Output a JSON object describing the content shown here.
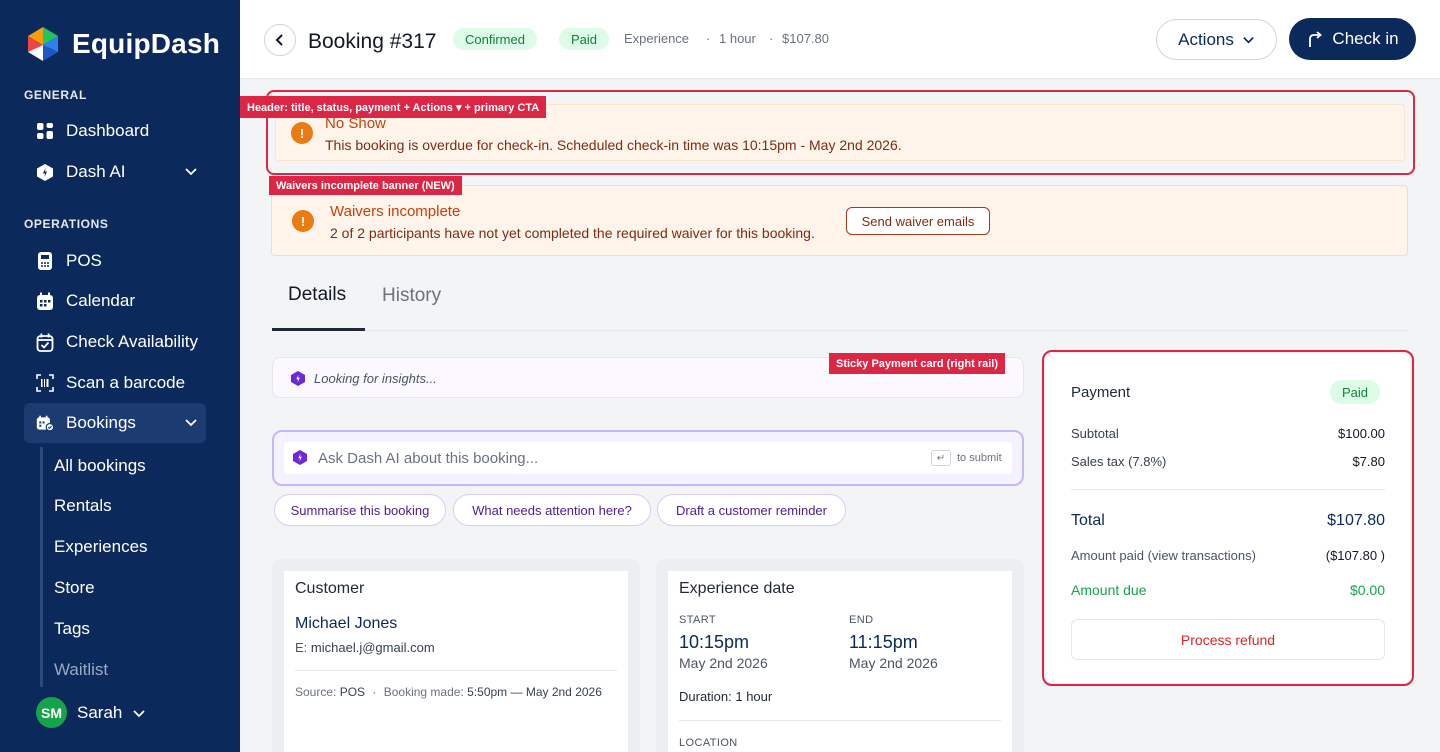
{
  "app": {
    "name": "EquipDash"
  },
  "sidebar": {
    "section_general": "GENERAL",
    "section_operations": "OPERATIONS",
    "items": [
      {
        "label": "Dashboard",
        "icon": "grid-icon"
      },
      {
        "label": "Dash AI",
        "icon": "ai-hex-icon"
      },
      {
        "label": "POS",
        "icon": "pos-terminal-icon"
      },
      {
        "label": "Calendar",
        "icon": "calendar-icon"
      },
      {
        "label": "Check Availability",
        "icon": "calendar-check-icon"
      },
      {
        "label": "Scan a barcode",
        "icon": "barcode-scan-icon"
      },
      {
        "label": "Bookings",
        "icon": "bookings-icon"
      }
    ],
    "sub_items": [
      {
        "label": "All bookings"
      },
      {
        "label": "Rentals"
      },
      {
        "label": "Experiences"
      },
      {
        "label": "Store"
      },
      {
        "label": "Tags"
      },
      {
        "label": "Waitlist"
      }
    ],
    "user": {
      "initials": "SM",
      "name": "Sarah"
    }
  },
  "header": {
    "title": "Booking #317",
    "status": "Confirmed",
    "payment_status": "Paid",
    "type": "Experience",
    "sep1": "·",
    "duration": "1 hour",
    "sep2": "·",
    "amount": "$107.80",
    "actions_label": "Actions",
    "checkin_label": "Check in"
  },
  "annotations": {
    "header_tag": "Header: title, status, payment + Actions ▾ + primary CTA",
    "waivers_tag": "Waivers incomplete banner (NEW)",
    "payment_tag": "Sticky Payment card (right rail)"
  },
  "banners": {
    "no_show": {
      "title": "No Show",
      "text": "This booking is overdue for check-in. Scheduled check-in time was 10:15pm - May 2nd 2026."
    },
    "waivers": {
      "title": "Waivers incomplete",
      "text": "2 of 2 participants have not yet completed the required waiver for this booking.",
      "button": "Send waiver emails"
    }
  },
  "tabs": [
    {
      "label": "Details"
    },
    {
      "label": "History"
    }
  ],
  "insights": {
    "text": "Looking for insights..."
  },
  "ai": {
    "placeholder": "Ask Dash AI about this booking...",
    "enter_key": "↵",
    "submit_hint": "to submit",
    "chips": [
      {
        "label": "Summarise this booking"
      },
      {
        "label": "What needs attention here?"
      },
      {
        "label": "Draft a customer reminder"
      }
    ]
  },
  "customer": {
    "title": "Customer",
    "name": "Michael Jones",
    "email_prefix": "E:",
    "email": "michael.j@gmail.com",
    "source_label": "Source:",
    "source": "POS",
    "sep": "·",
    "made_label": "Booking made:",
    "made": "5:50pm — May 2nd 2026"
  },
  "experience": {
    "title": "Experience date",
    "start_label": "START",
    "start_time": "10:15pm",
    "start_date": "May 2nd 2026",
    "end_label": "END",
    "end_time": "11:15pm",
    "end_date": "May 2nd 2026",
    "duration": "Duration: 1 hour",
    "location_label": "LOCATION"
  },
  "payment": {
    "title": "Payment",
    "badge": "Paid",
    "subtotal_label": "Subtotal",
    "subtotal": "$100.00",
    "tax_label": "Sales tax (7.8%)",
    "tax": "$7.80",
    "total_label": "Total",
    "total": "$107.80",
    "paid_label": "Amount paid (view transactions)",
    "paid": "($107.80 )",
    "due_label": "Amount due",
    "due": "$0.00",
    "refund_label": "Process refund"
  },
  "colors": {
    "sidebar_bg": "#0b2a5b",
    "primary": "#0b2a5b",
    "annotation": "#dc2646",
    "warning": "#ea7a12",
    "success": "#16a34a"
  }
}
